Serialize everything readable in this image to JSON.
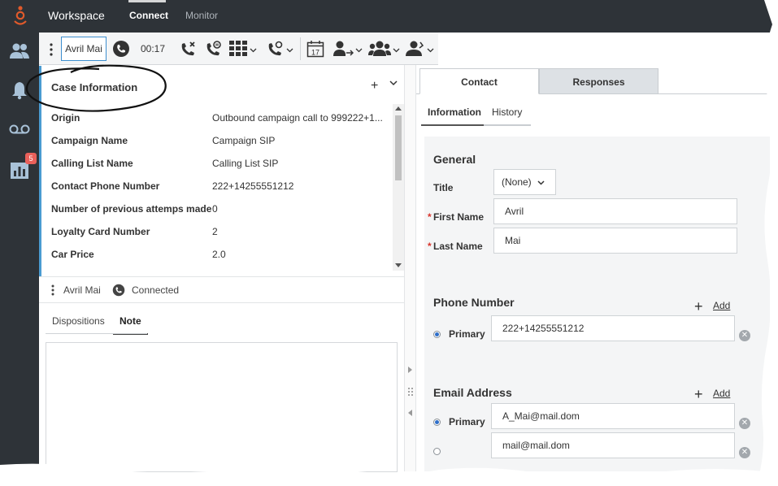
{
  "topbar": {
    "app_title": "Workspace",
    "nav": [
      {
        "label": "Connect",
        "active": true
      },
      {
        "label": "Monitor",
        "active": false
      }
    ],
    "accent_color": "#e05a2b"
  },
  "sidebar": {
    "items": [
      {
        "icon": "contacts-icon"
      },
      {
        "icon": "bell-icon"
      },
      {
        "icon": "voicemail-icon"
      },
      {
        "icon": "statistics-icon",
        "badge": "5"
      }
    ]
  },
  "toolbar": {
    "party_name": "Avril Mai",
    "timer": "00:17",
    "icons": [
      "phone-icon",
      "end-call-icon",
      "hold-call-icon",
      "keypad-icon",
      "consult-call-icon",
      "schedule-callback-icon",
      "transfer-icon",
      "conference-icon",
      "instant-transfer-icon"
    ]
  },
  "case_info": {
    "title": "Case Information",
    "fields": [
      {
        "label": "Origin",
        "value": "Outbound campaign call to 999222+1..."
      },
      {
        "label": "Campaign Name",
        "value": "Campaign SIP"
      },
      {
        "label": "Calling List Name",
        "value": "Calling List SIP"
      },
      {
        "label": "Contact Phone Number",
        "value": "222+14255551212"
      },
      {
        "label": "Number of previous attemps made",
        "value": "0"
      },
      {
        "label": "Loyalty Card Number",
        "value": "2"
      },
      {
        "label": "Car Price",
        "value": "2.0"
      }
    ]
  },
  "party": {
    "name": "Avril Mai",
    "state": "Connected"
  },
  "disposition_tabs": [
    {
      "label": "Dispositions",
      "active": false
    },
    {
      "label": "Note",
      "active": true
    }
  ],
  "right_tabs": [
    {
      "label": "Contact",
      "active": true
    },
    {
      "label": "Responses",
      "active": false
    }
  ],
  "contact_subtabs": [
    {
      "label": "Information",
      "active": true
    },
    {
      "label": "History",
      "active": false
    }
  ],
  "contact_form": {
    "general_title": "General",
    "title_label": "Title",
    "title_value": "(None)",
    "first_name_label": "First Name",
    "first_name_value": "Avril",
    "last_name_label": "Last Name",
    "last_name_value": "Mai",
    "required_mark": "*",
    "phone_title": "Phone Number",
    "add_label": "Add",
    "primary_label": "Primary",
    "phone_value": "222+14255551212",
    "email_title": "Email Address",
    "email_primary": "A_Mai@mail.dom",
    "email_secondary": "mail@mail.dom"
  }
}
